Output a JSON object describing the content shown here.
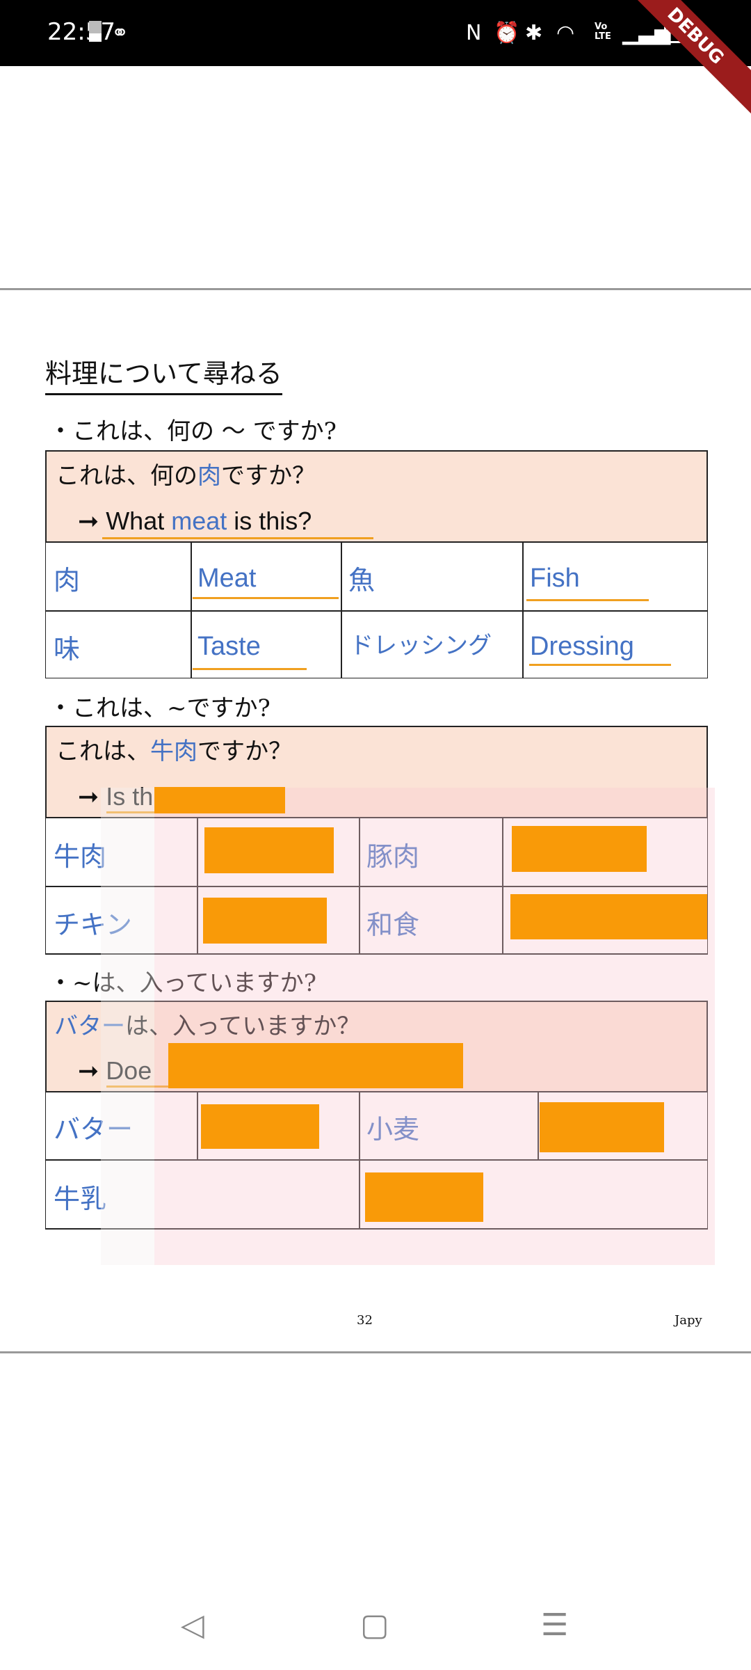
{
  "status_bar": {
    "time": "22:57",
    "icons": [
      "sim-icon",
      "vpn-icon",
      "nfc-icon",
      "alarm-icon",
      "bluetooth-icon",
      "wifi-icon",
      "volte-icon",
      "signal-icon",
      "battery-icon"
    ],
    "debug_banner": "DEBUG"
  },
  "page": {
    "title": "料理について尋ねる",
    "sections": [
      {
        "bullet": "・これは、何の ～ ですか?",
        "header_jp_pre": "これは、何の",
        "header_jp_blue": "肉",
        "header_jp_post": "ですか？",
        "arrow": "➞",
        "header_en_pre": "What ",
        "header_en_blue": "meat",
        "header_en_post": " is this?",
        "cells": [
          "肉",
          "Meat",
          "魚",
          "Fish",
          "味",
          "Taste",
          "ドレッシング",
          "Dressing"
        ]
      },
      {
        "bullet": "・これは、~ですか?",
        "header_jp_pre": "これは、",
        "header_jp_blue": "牛肉",
        "header_jp_post": "ですか？",
        "arrow": "➞",
        "header_en_pre": "Is th",
        "cells": [
          "牛肉",
          "豚肉",
          "チキン",
          "和食"
        ]
      },
      {
        "bullet": "・~は、入っていますか?",
        "header_jp_blue": "バター",
        "header_jp_post": "は、入っていますか？",
        "arrow": "➞",
        "header_en_pre": "Doe",
        "cells": [
          "バター",
          "小麦",
          "牛乳"
        ]
      }
    ],
    "page_number": "32",
    "footer_right": "Japy"
  },
  "colors": {
    "accent_blue": "#4472c4",
    "header_bg": "#fbe3d6",
    "underline": "#f0a020",
    "redaction": "#f99a08"
  },
  "nav_bar": {
    "back": "◁",
    "home": "▢",
    "menu": "☰"
  }
}
